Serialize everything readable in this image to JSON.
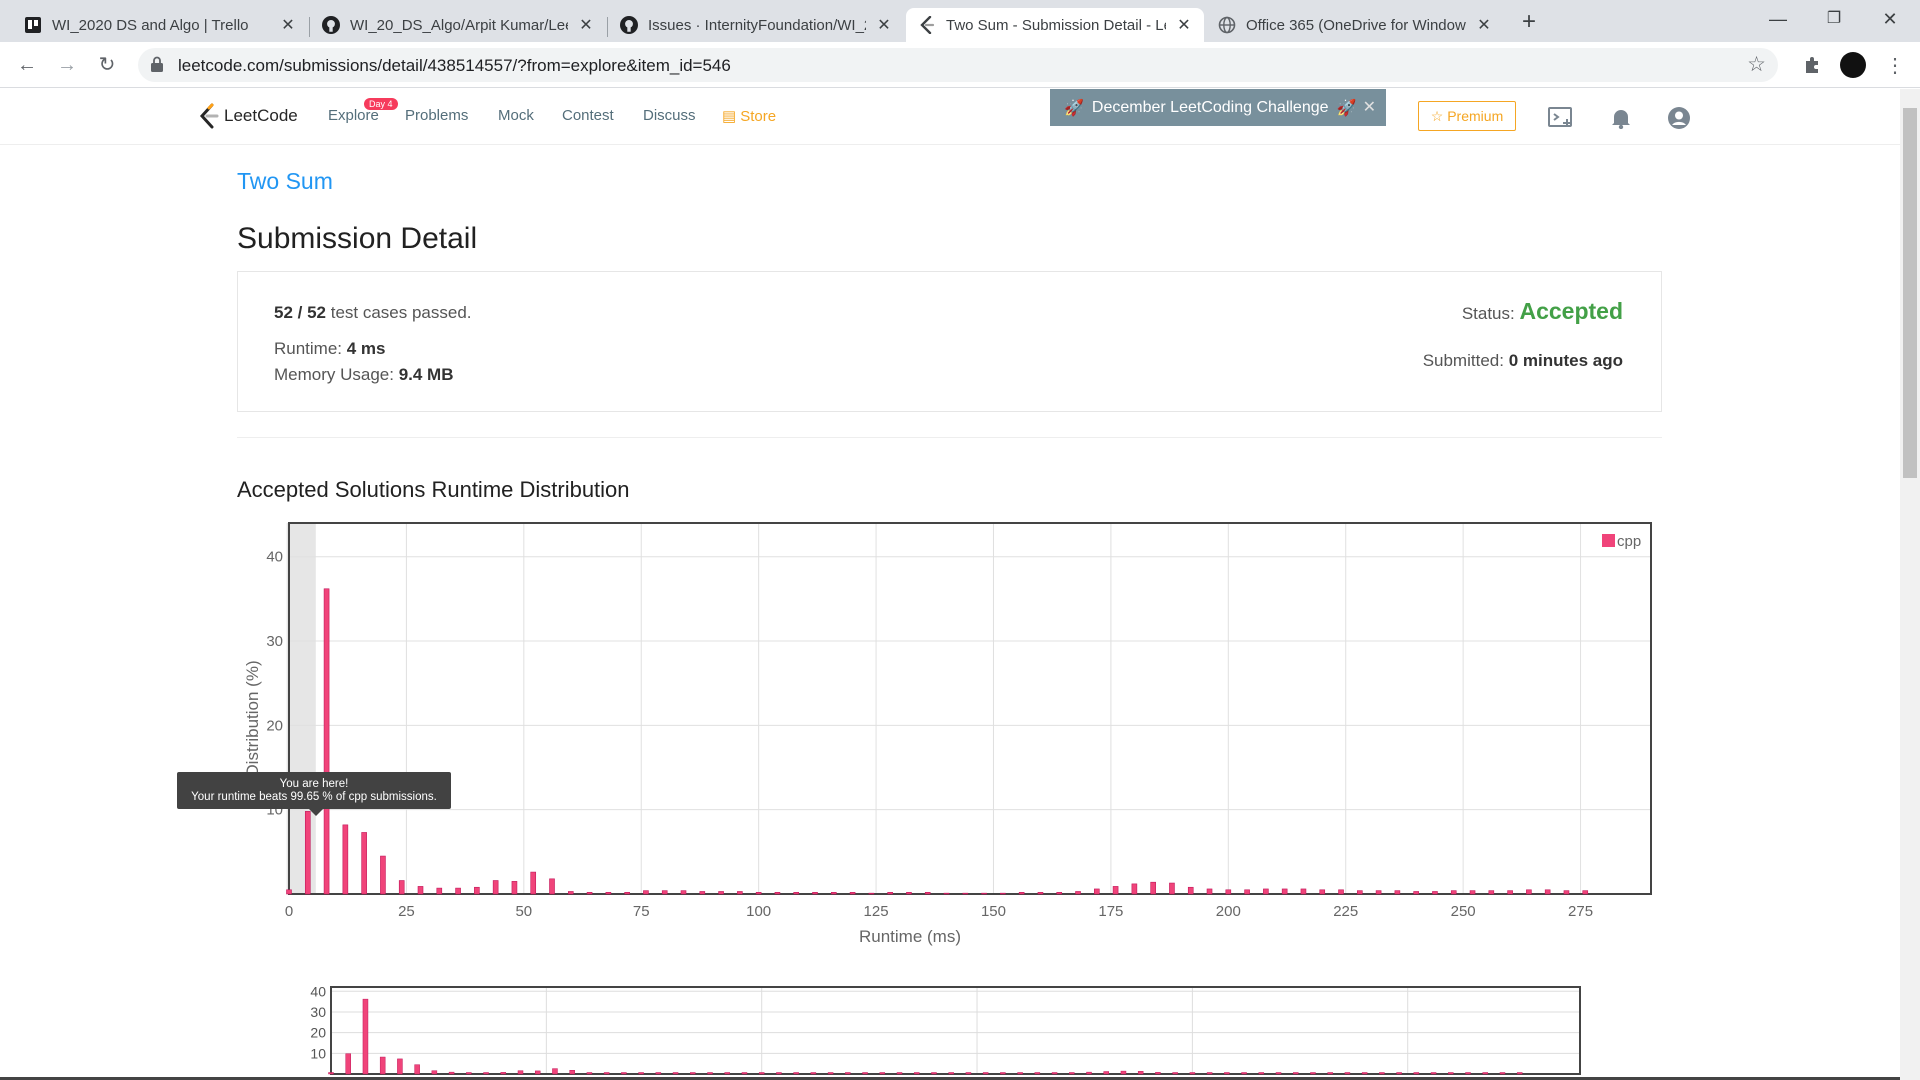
{
  "browser": {
    "tabs": [
      {
        "title": "WI_2020 DS and Algo | Trello",
        "icon": "trello-icon",
        "active": false
      },
      {
        "title": "WI_20_DS_Algo/Arpit Kumar/Lee",
        "icon": "github-icon",
        "active": false
      },
      {
        "title": "Issues · InternityFoundation/WI_2",
        "icon": "github-icon",
        "active": false
      },
      {
        "title": "Two Sum - Submission Detail - Le",
        "icon": "leetcode-icon",
        "active": true
      },
      {
        "title": "Office 365 (OneDrive for Window",
        "icon": "globe-icon",
        "active": false
      }
    ],
    "url": "leetcode.com/submissions/detail/438514557/?from=explore&item_id=546"
  },
  "nav": {
    "logo": "LeetCode",
    "explore": "Explore",
    "explore_badge": "Day 4",
    "problems": "Problems",
    "mock": "Mock",
    "contest": "Contest",
    "discuss": "Discuss",
    "store": "Store",
    "challenge": "December LeetCoding Challenge",
    "premium": "Premium"
  },
  "problem_title": "Two Sum",
  "page_title": "Submission Detail",
  "summary": {
    "passed": "52 / 52",
    "passed_suffix": " test cases passed.",
    "runtime_label": "Runtime: ",
    "runtime": "4 ms",
    "memory_label": "Memory Usage: ",
    "memory": "9.4 MB",
    "status_label": "Status: ",
    "status": "Accepted",
    "submitted_label": "Submitted: ",
    "submitted": "0 minutes ago"
  },
  "distribution_heading": "Accepted Solutions Runtime Distribution",
  "tooltip": {
    "line1": "You are here!",
    "line2": "Your runtime beats 99.65 % of cpp submissions."
  },
  "chart_data": {
    "type": "bar",
    "xlabel": "Runtime (ms)",
    "ylabel": "Distribution (%)",
    "xlim": [
      0,
      290
    ],
    "ylim": [
      0,
      44
    ],
    "xticks": [
      0,
      25,
      50,
      75,
      100,
      125,
      150,
      175,
      200,
      225,
      250,
      275
    ],
    "yticks": [
      10,
      20,
      30,
      40
    ],
    "highlight_x": 4,
    "series": [
      {
        "name": "cpp",
        "color": "#f0447a",
        "x": [
          0,
          4,
          8,
          12,
          16,
          20,
          24,
          28,
          32,
          36,
          40,
          44,
          48,
          52,
          56,
          60,
          64,
          68,
          72,
          76,
          80,
          84,
          88,
          92,
          96,
          100,
          104,
          108,
          112,
          116,
          120,
          124,
          128,
          132,
          136,
          140,
          144,
          148,
          152,
          156,
          160,
          164,
          168,
          172,
          176,
          180,
          184,
          188,
          192,
          196,
          200,
          204,
          208,
          212,
          216,
          220,
          224,
          228,
          232,
          236,
          240,
          244,
          248,
          252,
          256,
          260,
          264,
          268,
          272,
          276
        ],
        "values": [
          0.5,
          9.8,
          36.2,
          8.2,
          7.3,
          4.5,
          1.6,
          0.9,
          0.7,
          0.7,
          0.8,
          1.6,
          1.5,
          2.6,
          1.8,
          0.3,
          0.2,
          0.2,
          0.2,
          0.4,
          0.4,
          0.4,
          0.3,
          0.3,
          0.3,
          0.2,
          0.2,
          0.2,
          0.2,
          0.2,
          0.2,
          0.1,
          0.2,
          0.2,
          0.2,
          0.1,
          0.1,
          0.1,
          0.1,
          0.2,
          0.2,
          0.2,
          0.3,
          0.6,
          0.9,
          1.2,
          1.4,
          1.3,
          0.8,
          0.6,
          0.5,
          0.5,
          0.6,
          0.6,
          0.6,
          0.5,
          0.5,
          0.4,
          0.4,
          0.4,
          0.3,
          0.3,
          0.4,
          0.4,
          0.4,
          0.4,
          0.5,
          0.5,
          0.4,
          0.4
        ]
      }
    ]
  },
  "overview": {
    "yticks": [
      10,
      20,
      30,
      40
    ]
  }
}
